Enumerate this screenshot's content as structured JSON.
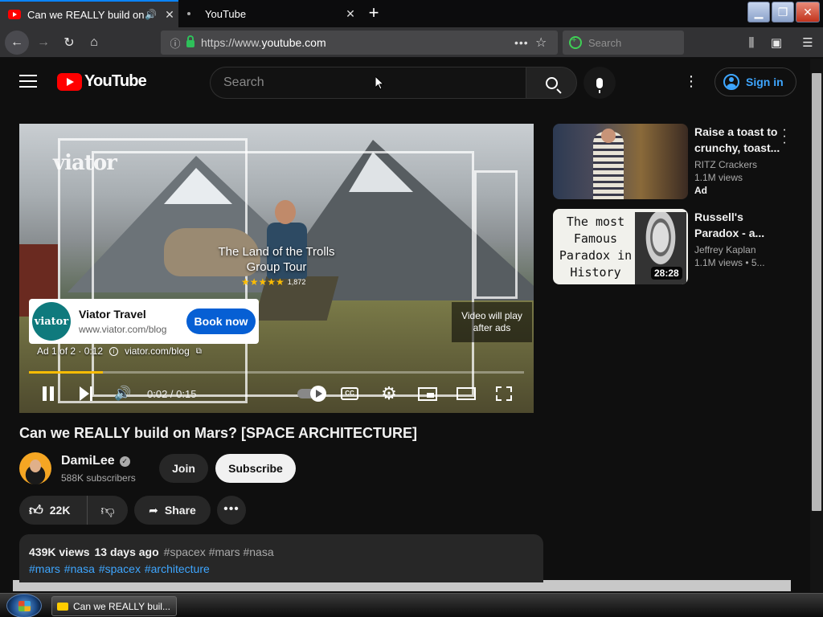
{
  "browser": {
    "tabs": [
      {
        "title": "Can we REALLY build on Mars? [SPACE ARCHITECTURE] - YouTube",
        "active": true
      },
      {
        "title": "YouTube",
        "active": false
      }
    ],
    "url_prefix": "https://www.",
    "url_domain": "youtube.com",
    "search_placeholder": "Search",
    "accent_color": "#0a84ff"
  },
  "yt_header": {
    "logo_text": "YouTube",
    "search_placeholder": "Search",
    "signin_label": "Sign in"
  },
  "player": {
    "watermark": "viator",
    "ad_headline_line1": "The Land of the Trolls",
    "ad_headline_line2": "Group Tour",
    "ad_stars": "★★★★★",
    "ad_rating_count": "1,872",
    "ad_card": {
      "logo_text": "viator",
      "advertiser": "Viator Travel",
      "domain": "www.viator.com/blog",
      "cta": "Book now"
    },
    "ad_meta": {
      "counter": "Ad 1 of 2 · 0:12",
      "info_glyph": "i",
      "link": "viator.com/blog"
    },
    "video_will_play": "Video will play after ads",
    "time": "0:02 / 0:15",
    "progress_fraction": 0.15,
    "cc_label": "CC"
  },
  "video": {
    "title": "Can we REALLY build on Mars? [SPACE ARCHITECTURE]",
    "channel": "DamiLee",
    "subscribers": "588K subscribers",
    "join_label": "Join",
    "subscribe_label": "Subscribe",
    "likes": "22K",
    "share_label": "Share",
    "views": "439K views",
    "age": "13 days ago",
    "top_tags": "#spacex #mars #nasa",
    "desc_tags": "#mars #nasa #spacex #architecture"
  },
  "recommendations": [
    {
      "title": "Raise a toast to crunchy, toast...",
      "channel": "RITZ Crackers",
      "views": "1.1M views",
      "badge": "Ad"
    },
    {
      "title": "Russell's Paradox - a...",
      "channel": "Jeffrey Kaplan",
      "views": "1.1M views  • 5...",
      "duration": "28:28",
      "thumb_text": "The most Famous Paradox in History"
    }
  ],
  "taskbar": {
    "task_title": "Can we REALLY buil..."
  }
}
